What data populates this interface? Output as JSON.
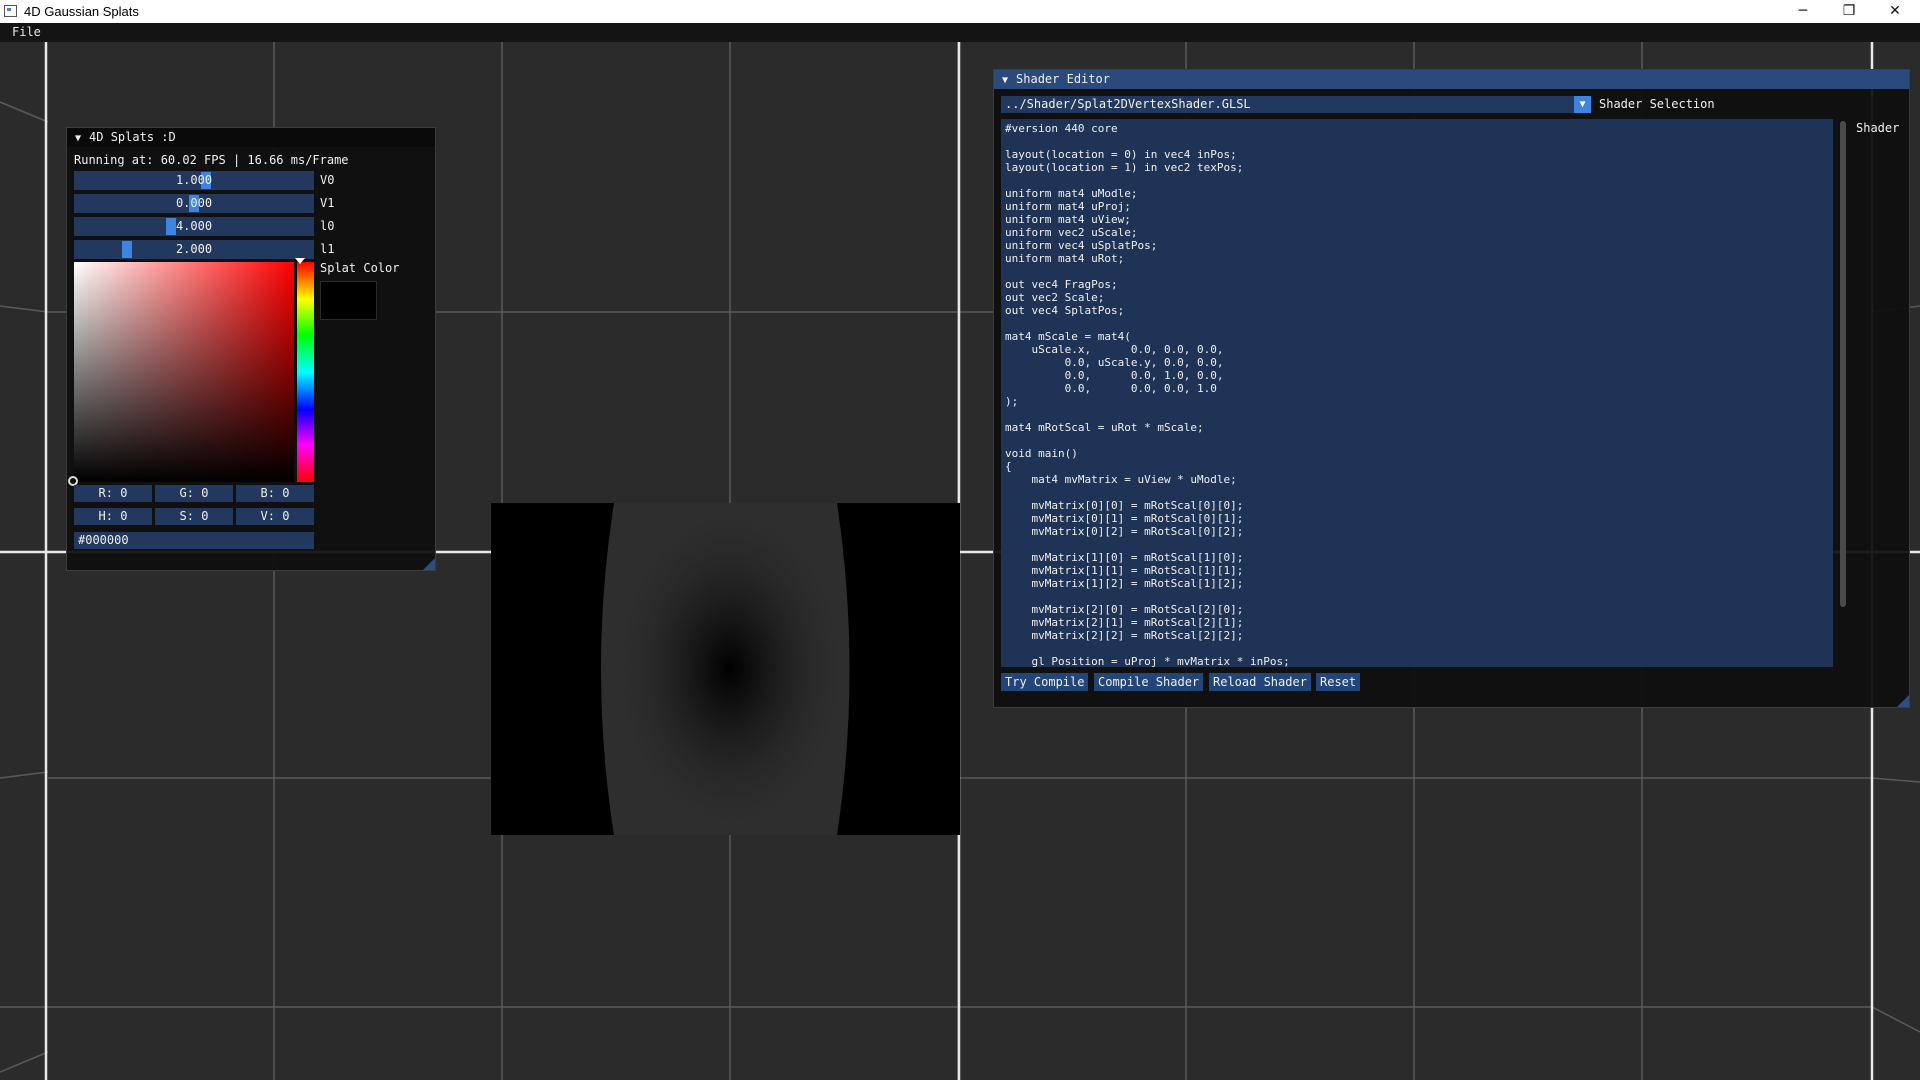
{
  "window": {
    "title": "4D Gaussian Splats",
    "minimize_glyph": "─",
    "maximize_glyph": "❐",
    "close_glyph": "✕"
  },
  "menubar": {
    "file": "File"
  },
  "splats_panel": {
    "title": "4D Splats :D",
    "collapse_glyph": "▼",
    "fps_text": "Running at: 60.02 FPS | 16.66 ms/Frame",
    "sliders": [
      {
        "label": "V0",
        "value": "1.000",
        "fraction": 0.55
      },
      {
        "label": "V1",
        "value": "0.000",
        "fraction": 0.5
      },
      {
        "label": "l0",
        "value": "4.000",
        "fraction": 0.4
      },
      {
        "label": "l1",
        "value": "2.000",
        "fraction": 0.21
      }
    ],
    "color_label": "Splat Color",
    "color_value": "#000000",
    "rgb": {
      "r": "R:  0",
      "g": "G:  0",
      "b": "B:  0"
    },
    "hsv": {
      "h": "H:  0",
      "s": "S:  0",
      "v": "V:  0"
    },
    "hex": "#000000"
  },
  "shader_editor": {
    "title": "Shader Editor",
    "collapse_glyph": "▼",
    "path": "../Shader/Splat2DVertexShader.GLSL",
    "combo_arrow": "▼",
    "selection_label": "Shader Selection",
    "side_label": "Shader",
    "code": "#version 440 core\n\nlayout(location = 0) in vec4 inPos;\nlayout(location = 1) in vec2 texPos;\n\nuniform mat4 uModle;\nuniform mat4 uProj;\nuniform mat4 uView;\nuniform vec2 uScale;\nuniform vec4 uSplatPos;\nuniform mat4 uRot;\n\nout vec4 FragPos;\nout vec2 Scale;\nout vec4 SplatPos;\n\nmat4 mScale = mat4(\n    uScale.x,      0.0, 0.0, 0.0,\n         0.0, uScale.y, 0.0, 0.0,\n         0.0,      0.0, 1.0, 0.0,\n         0.0,      0.0, 0.0, 1.0\n);\n\nmat4 mRotScal = uRot * mScale;\n\nvoid main()\n{\n    mat4 mvMatrix = uView * uModle;\n\n    mvMatrix[0][0] = mRotScal[0][0];\n    mvMatrix[0][1] = mRotScal[0][1];\n    mvMatrix[0][2] = mRotScal[0][2];\n\n    mvMatrix[1][0] = mRotScal[1][0];\n    mvMatrix[1][1] = mRotScal[1][1];\n    mvMatrix[1][2] = mRotScal[1][2];\n\n    mvMatrix[2][0] = mRotScal[2][0];\n    mvMatrix[2][1] = mRotScal[2][1];\n    mvMatrix[2][2] = mRotScal[2][2];\n\n    gl_Position = uProj * mvMatrix * inPos;",
    "buttons": {
      "try_compile": "Try Compile",
      "compile": "Compile Shader",
      "reload": "Reload Shader",
      "reset": "Reset"
    }
  },
  "colors": {
    "accent": "#3d85e0",
    "frame_bg": "#22385e",
    "active_title": "#294a7a",
    "viewport_bg": "#2b2b2b"
  }
}
